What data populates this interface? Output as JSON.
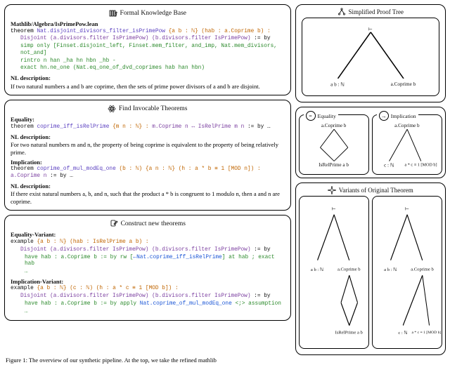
{
  "leftPanels": {
    "formalKB": {
      "title": "Formal Knowledge Base",
      "path": "Mathlib/Algebra/IsPrimePow.lean",
      "thm_kw": "theorem",
      "thm_name": "Nat.disjoint_divisors_filter_isPrimePow",
      "thm_args": "{a b : ℕ} (hab : a.Coprime b) :",
      "thm_type": "Disjoint (a.divisors.filter IsPrimePow) (b.divisors.filter IsPrimePow)",
      "thm_by": ":= by",
      "thm_body1": "simp only [Finset.disjoint_left, Finset.mem_filter, and_imp, Nat.mem_divisors, not_and]",
      "thm_body2": "rintro n han _ha hn hbn _hb -",
      "thm_body3": "exact hn.ne_one (Nat.eq_one_of_dvd_coprimes hab han hbn)",
      "nl_head": "NL description:",
      "nl_text": "If two natural numbers a and b are coprime, then the sets of prime power divisors of a and b are disjoint."
    },
    "findInvocable": {
      "title": "Find Invocable Theorems",
      "eq_head": "Equality:",
      "eq_kw": "theorem",
      "eq_name": "coprime_iff_isRelPrime",
      "eq_args": "{m n : ℕ} :",
      "eq_type": "m.Coprime n ↔ IsRelPrime m n",
      "eq_tail": ":= by …",
      "eq_nl_head": "NL description:",
      "eq_nl_text": "For two natural numbers m and n, the property of being coprime is equivalent to the property of being relatively prime.",
      "imp_head": "Implication:",
      "imp_kw": "theorem",
      "imp_name": "coprime_of_mul_modEq_one",
      "imp_args": "(b : ℕ) {a n : ℕ} (h : a * b ≡ 1 [MOD n]) :",
      "imp_type": "a.Coprime n",
      "imp_tail": ":= by …",
      "imp_nl_head": "NL description:",
      "imp_nl_text": "If there exist natural numbers a, b, and n, such that the product a * b is congruent to 1 modulo n, then a and n are coprime."
    },
    "construct": {
      "title": "Construct new theorems",
      "eqv_head": "Equality-Variant:",
      "eqv_kw": "example",
      "eqv_args": "{a b : ℕ} (hab : IsRelPrime a b) :",
      "eqv_type": "Disjoint (a.divisors.filter IsPrimePow) (b.divisors.filter IsPrimePow)",
      "eqv_by": ":= by",
      "eqv_body1": "have hab : a.Coprime b := by rw [←Nat.coprime_iff_isRelPrime] at hab ; exact hab",
      "eqv_dots": "…",
      "impv_head": "Implication-Variant:",
      "impv_kw": "example",
      "impv_args": "{a b : ℕ} (c : ℕ) (h : a * c ≡ 1 [MOD b]) :",
      "impv_type": "Disjoint (a.divisors.filter IsPrimePow) (b.divisors.filter IsPrimePow)",
      "impv_by": ":= by",
      "impv_body1": "have hab : a.Coprime b := by apply Nat.coprime_of_mul_modEq_one <;> assumption",
      "impv_dots": "…"
    }
  },
  "rightPanels": {
    "simplified": {
      "title": "Simplified Proof Tree",
      "root": "⊢",
      "leafL": "a b : ℕ",
      "leafR": "a.Coprime b"
    },
    "eqImp": {
      "eqLabel": "Equality",
      "impLabel": "Implication",
      "eqRoot": "a.Coprime b",
      "eqLeaf": "IsRelPrime a b",
      "impRoot": "a.Coprime b",
      "impLeafL": "c : ℕ",
      "impLeafR": "a * c ≡ 1 [MOD b]"
    },
    "variants": {
      "title": "Variants of Original Theorem",
      "rootL": "⊢",
      "rootR": "⊢",
      "lL1": "a b : ℕ",
      "lR1": "a.Coprime b",
      "rL1": "a b : ℕ",
      "rR1": "a.Coprime b",
      "lLeaf": "IsRelPrime a b",
      "rLeafL": "c : ℕ",
      "rLeafR": "a * c ≡ 1 [MOD b]"
    }
  },
  "caption": "Figure 1: The overview of our synthetic pipeline. At the top, we take the refined mathlib"
}
